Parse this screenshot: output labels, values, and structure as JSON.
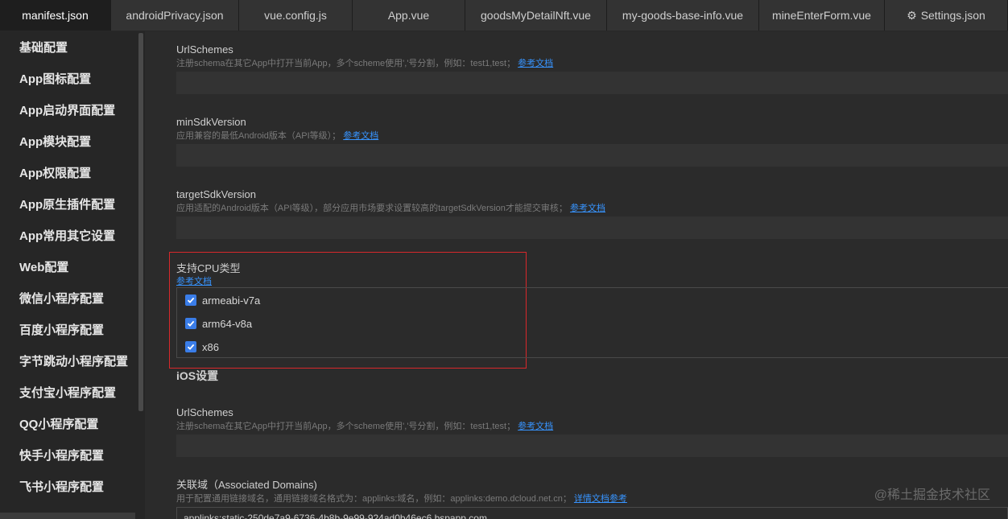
{
  "tabs": [
    {
      "label": "manifest.json",
      "active": true
    },
    {
      "label": "androidPrivacy.json"
    },
    {
      "label": "vue.config.js"
    },
    {
      "label": "App.vue"
    },
    {
      "label": "goodsMyDetailNft.vue"
    },
    {
      "label": "my-goods-base-info.vue"
    },
    {
      "label": "mineEnterForm.vue"
    },
    {
      "label": "Settings.json",
      "icon": "gear-icon"
    }
  ],
  "sidebar": {
    "items": [
      {
        "label": "基础配置"
      },
      {
        "label": "App图标配置"
      },
      {
        "label": "App启动界面配置"
      },
      {
        "label": "App模块配置"
      },
      {
        "label": "App权限配置"
      },
      {
        "label": "App原生插件配置"
      },
      {
        "label": "App常用其它设置"
      },
      {
        "label": "Web配置"
      },
      {
        "label": "微信小程序配置"
      },
      {
        "label": "百度小程序配置"
      },
      {
        "label": "字节跳动小程序配置"
      },
      {
        "label": "支付宝小程序配置"
      },
      {
        "label": "QQ小程序配置"
      },
      {
        "label": "快手小程序配置"
      },
      {
        "label": "飞书小程序配置"
      }
    ]
  },
  "android": {
    "url_schemes": {
      "label": "UrlSchemes",
      "desc": "注册schema在其它App中打开当前App，多个scheme使用','号分割，例如：test1,test；",
      "link": "参考文档",
      "value": ""
    },
    "min_sdk": {
      "label": "minSdkVersion",
      "desc": "应用兼容的最低Android版本（API等级）；",
      "link": "参考文档",
      "value": ""
    },
    "target_sdk": {
      "label": "targetSdkVersion",
      "desc": "应用适配的Android版本（API等级），部分应用市场要求设置较高的targetSdkVersion才能提交审核；",
      "link": "参考文档",
      "value": ""
    },
    "cpu": {
      "label": "支持CPU类型",
      "link": "参考文档",
      "options": [
        {
          "label": "armeabi-v7a",
          "checked": true
        },
        {
          "label": "arm64-v8a",
          "checked": true
        },
        {
          "label": "x86",
          "checked": true
        }
      ]
    }
  },
  "ios": {
    "section_title": "iOS设置",
    "url_schemes": {
      "label": "UrlSchemes",
      "desc": "注册schema在其它App中打开当前App，多个scheme使用','号分割，例如：test1,test；",
      "link": "参考文档",
      "value": ""
    },
    "associated_domains": {
      "label": "关联域（Associated Domains)",
      "desc": "用于配置通用链接域名，通用链接域名格式为：applinks:域名，例如：applinks:demo.dcloud.net.cn；",
      "link": "详情文档参考",
      "value": "applinks:static-250de7a9-6736-4b8b-9e99-924ad0b46ec6.bspapp.com"
    }
  },
  "watermark": "@稀土掘金技术社区",
  "colors": {
    "accent": "#3a7de8",
    "link": "#3794ff",
    "highlight_border": "#d8282b"
  }
}
